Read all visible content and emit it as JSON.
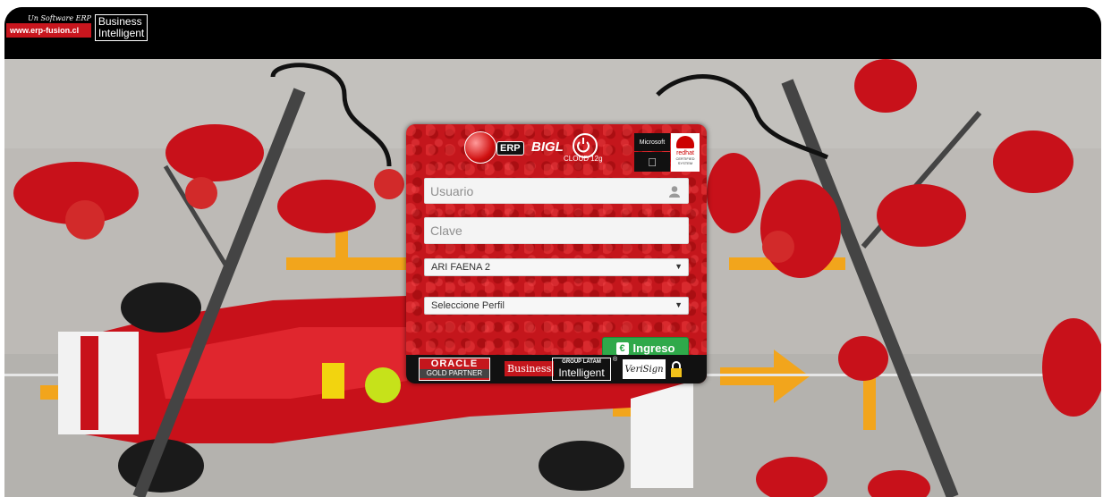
{
  "header": {
    "tagline": "Un Software ERP",
    "url": "www.erp-fusion.cl",
    "bi_label_line1": "Business",
    "bi_label_line2": "Intelligent"
  },
  "login": {
    "logo_erp": "ERP",
    "logo_bigl": "BIGL",
    "cloud_label": "CLOUD 12g",
    "badges": {
      "microsoft": "Microsoft",
      "redhat": "redhat",
      "redhat_sub": "CERTIFIED SYSTEM"
    },
    "username_placeholder": "Usuario",
    "password_placeholder": "Clave",
    "company_value": "ARI FAENA 2",
    "profile_value": "Seleccione Perfil",
    "submit_label": "Ingreso"
  },
  "partners": {
    "oracle_top": "ORACLE",
    "oracle_bottom": "GOLD PARTNER",
    "business": "Business",
    "group_top": "GROUP LATAM",
    "group_bottom": "Intelligent",
    "reg": "®",
    "verisign": "VeriSign"
  },
  "colors": {
    "card_red": "#c4161c",
    "button_green": "#2fa94a",
    "pit_yellow": "#f2a51c"
  },
  "icons": {
    "user": "user-icon",
    "lock": "lock-icon",
    "globe": "globe-icon",
    "cloud": "cloud-icon",
    "apple": "apple-icon"
  }
}
